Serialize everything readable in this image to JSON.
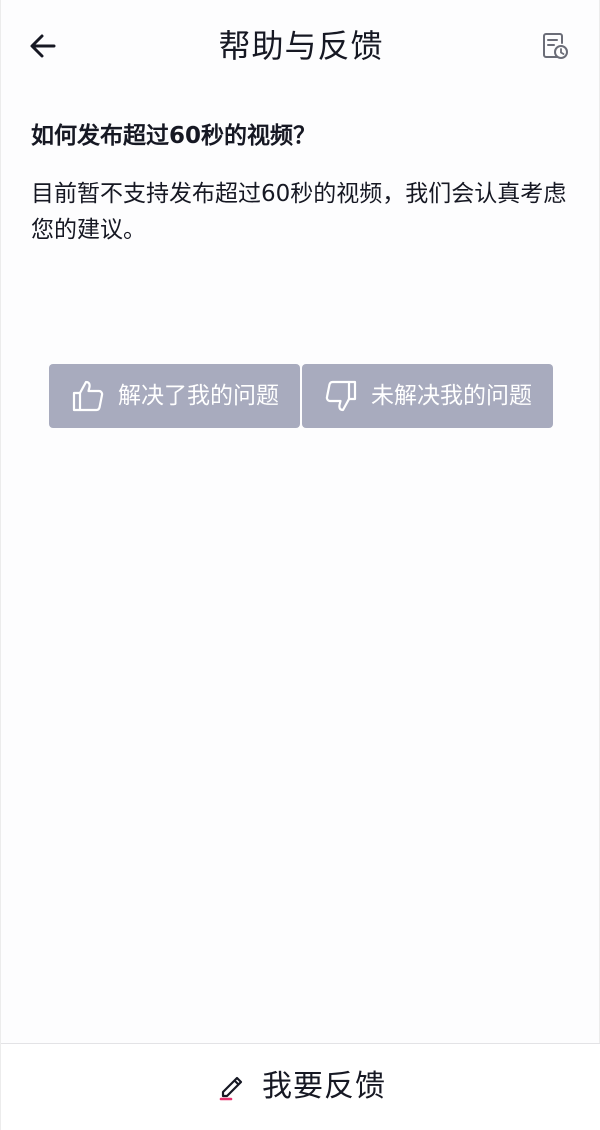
{
  "header": {
    "title": "帮助与反馈",
    "back_icon": "arrow-left-icon",
    "history_icon": "document-clock-icon"
  },
  "faq": {
    "question": "如何发布超过60秒的视频？",
    "answer": "目前暂不支持发布超过60秒的视频，我们会认真考虑您的建议。"
  },
  "feedback": {
    "solved_label": "解决了我的问题",
    "solved_icon": "thumbs-up-icon",
    "unsolved_label": "未解决我的问题",
    "unsolved_icon": "thumbs-down-icon",
    "button_color": "#a8abbe"
  },
  "footer": {
    "label": "我要反馈",
    "icon": "pencil-icon",
    "icon_accent": "#e6326e"
  }
}
